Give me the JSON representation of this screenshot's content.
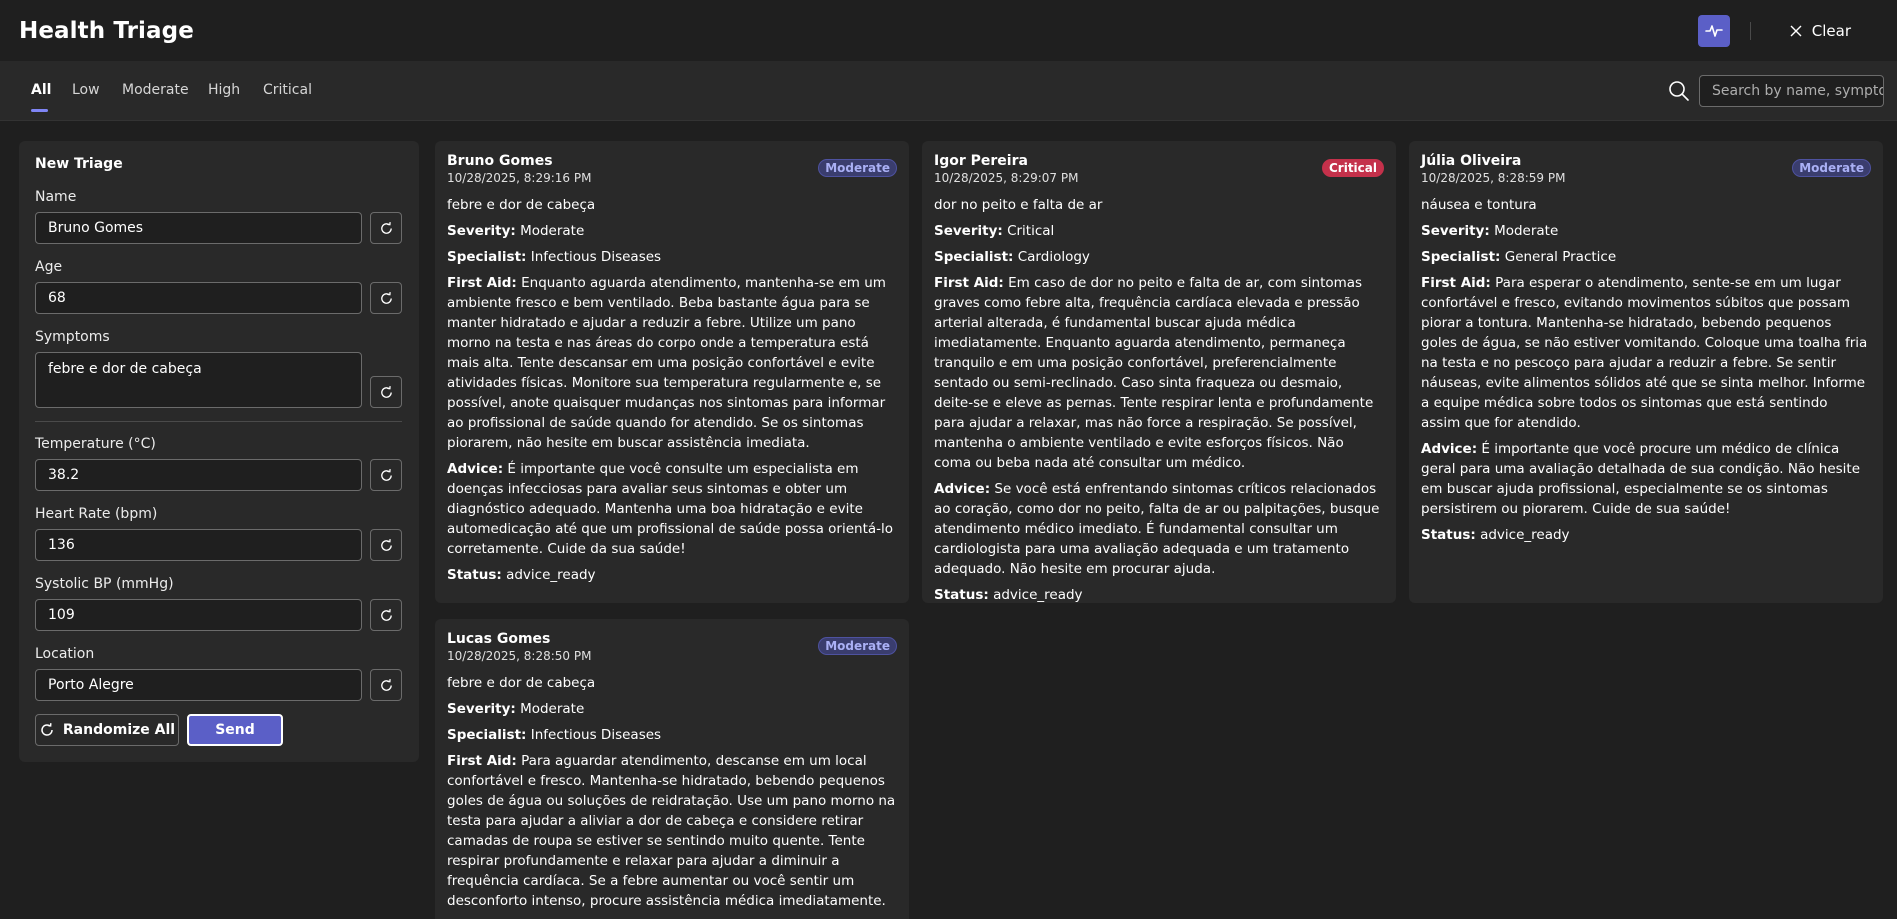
{
  "app": {
    "title": "Health Triage",
    "clear_label": "Clear"
  },
  "tabs": [
    {
      "label": "All"
    },
    {
      "label": "Low"
    },
    {
      "label": "Moderate"
    },
    {
      "label": "High"
    },
    {
      "label": "Critical"
    }
  ],
  "search": {
    "placeholder": "Search by name, symptom"
  },
  "form": {
    "title": "New Triage",
    "name_label": "Name",
    "name_value": "Bruno Gomes",
    "age_label": "Age",
    "age_value": "68",
    "symptoms_label": "Symptoms",
    "symptoms_value": "febre e dor de cabeça",
    "temp_label": "Temperature (°C)",
    "temp_value": "38.2",
    "hr_label": "Heart Rate (bpm)",
    "hr_value": "136",
    "bp_label": "Systolic BP (mmHg)",
    "bp_value": "109",
    "location_label": "Location",
    "location_value": "Porto Alegre",
    "randomize_all_label": "Randomize All",
    "send_label": "Send"
  },
  "labels": {
    "severity": "Severity:",
    "specialist": "Specialist:",
    "first_aid": "First Aid:",
    "advice": "Advice:",
    "status": "Status:"
  },
  "cards": [
    {
      "name": "Bruno Gomes",
      "time": "10/28/2025, 8:29:16 PM",
      "badge": "Moderate",
      "symptoms": "febre e dor de cabeça",
      "severity": "Moderate",
      "specialist": "Infectious Diseases",
      "first_aid": "Enquanto aguarda atendimento, mantenha-se em um ambiente fresco e bem ventilado. Beba bastante água para se manter hidratado e ajudar a reduzir a febre. Utilize um pano morno na testa e nas áreas do corpo onde a temperatura está mais alta. Tente descansar em uma posição confortável e evite atividades físicas. Monitore sua temperatura regularmente e, se possível, anote quaisquer mudanças nos sintomas para informar ao profissional de saúde quando for atendido. Se os sintomas piorarem, não hesite em buscar assistência imediata.",
      "advice": "É importante que você consulte um especialista em doenças infecciosas para avaliar seus sintomas e obter um diagnóstico adequado. Mantenha uma boa hidratação e evite automedicação até que um profissional de saúde possa orientá-lo corretamente. Cuide da sua saúde!",
      "status": "advice_ready"
    },
    {
      "name": "Igor Pereira",
      "time": "10/28/2025, 8:29:07 PM",
      "badge": "Critical",
      "symptoms": "dor no peito e falta de ar",
      "severity": "Critical",
      "specialist": "Cardiology",
      "first_aid": "Em caso de dor no peito e falta de ar, com sintomas graves como febre alta, frequência cardíaca elevada e pressão arterial alterada, é fundamental buscar ajuda médica imediatamente. Enquanto aguarda atendimento, permaneça tranquilo e em uma posição confortável, preferencialmente sentado ou semi-reclinado. Caso sinta fraqueza ou desmaio, deite-se e eleve as pernas. Tente respirar lenta e profundamente para ajudar a relaxar, mas não force a respiração. Se possível, mantenha o ambiente ventilado e evite esforços físicos. Não coma ou beba nada até consultar um médico.",
      "advice": "Se você está enfrentando sintomas críticos relacionados ao coração, como dor no peito, falta de ar ou palpitações, busque atendimento médico imediato. É fundamental consultar um cardiologista para uma avaliação adequada e um tratamento adequado. Não hesite em procurar ajuda.",
      "status": "advice_ready"
    },
    {
      "name": "Júlia Oliveira",
      "time": "10/28/2025, 8:28:59 PM",
      "badge": "Moderate",
      "symptoms": "náusea e tontura",
      "severity": "Moderate",
      "specialist": "General Practice",
      "first_aid": "Para esperar o atendimento, sente-se em um lugar confortável e fresco, evitando movimentos súbitos que possam piorar a tontura. Mantenha-se hidratado, bebendo pequenos goles de água, se não estiver vomitando. Coloque uma toalha fria na testa e no pescoço para ajudar a reduzir a febre. Se sentir náuseas, evite alimentos sólidos até que se sinta melhor. Informe a equipe médica sobre todos os sintomas que está sentindo assim que for atendido.",
      "advice": "É importante que você procure um médico de clínica geral para uma avaliação detalhada de sua condição. Não hesite em buscar ajuda profissional, especialmente se os sintomas persistirem ou piorarem. Cuide de sua saúde!",
      "status": "advice_ready"
    },
    {
      "name": "Lucas Gomes",
      "time": "10/28/2025, 8:28:50 PM",
      "badge": "Moderate",
      "symptoms": "febre e dor de cabeça",
      "severity": "Moderate",
      "specialist": "Infectious Diseases",
      "first_aid": "Para aguardar atendimento, descanse em um local confortável e fresco. Mantenha-se hidratado, bebendo pequenos goles de água ou soluções de reidratação. Use um pano morno na testa para ajudar a aliviar a dor de cabeça e considere retirar camadas de roupa se estiver se sentindo muito quente. Tente respirar profundamente e relaxar para ajudar a diminuir a frequência cardíaca. Se a febre aumentar ou você sentir um desconforto intenso, procure assistência médica imediatamente."
    }
  ]
}
